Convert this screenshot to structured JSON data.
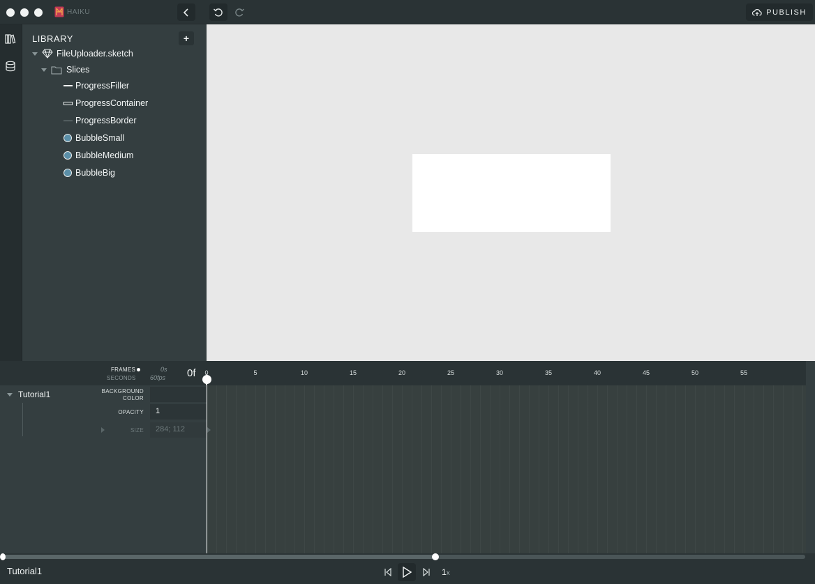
{
  "titlebar": {
    "brand": "HAIKU",
    "publish_label": "PUBLISH"
  },
  "library": {
    "title": "LIBRARY",
    "add_label": "+",
    "file": "FileUploader.sketch",
    "folder": "Slices",
    "layers": [
      {
        "label": "ProgressFiller",
        "icon": "line-icon"
      },
      {
        "label": "ProgressContainer",
        "icon": "rectangle-outline-icon"
      },
      {
        "label": "ProgressBorder",
        "icon": "thin-line-icon"
      },
      {
        "label": "BubbleSmall",
        "icon": "circle-icon"
      },
      {
        "label": "BubbleMedium",
        "icon": "circle-icon"
      },
      {
        "label": "BubbleBig",
        "icon": "circle-icon"
      }
    ]
  },
  "timeline": {
    "frames_label": "FRAMES",
    "seconds_label": "SECONDS",
    "time_value": "0s",
    "fps_value": "60fps",
    "frame_value": "0f",
    "ticks": [
      "0",
      "5",
      "10",
      "15",
      "20",
      "25",
      "30",
      "35",
      "40",
      "45",
      "50",
      "55"
    ],
    "component": "Tutorial1",
    "properties": {
      "bg_label_1": "BACKGROUND",
      "bg_label_2": "COLOR",
      "opacity_label": "OPACITY",
      "opacity_value": "1",
      "size_label": "SIZE",
      "size_value": "284; 112"
    }
  },
  "bottombar": {
    "component": "Tutorial1",
    "speed": "1",
    "speed_unit": "x"
  },
  "colors": {
    "stage": "#e8e8e8",
    "panel": "#343e40",
    "chrome": "#2a3335",
    "bubble": "#5b8fa8"
  }
}
